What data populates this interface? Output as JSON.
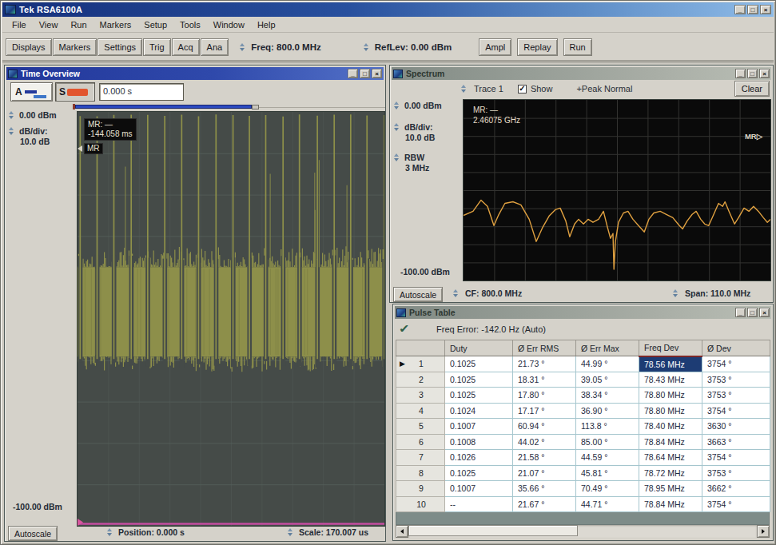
{
  "window": {
    "title": "Tek RSA6100A"
  },
  "menu": {
    "items": [
      "File",
      "View",
      "Run",
      "Markers",
      "Setup",
      "Tools",
      "Window",
      "Help"
    ]
  },
  "toolbar": {
    "buttons": [
      "Displays",
      "Markers",
      "Settings",
      "Trig",
      "Acq",
      "Ana"
    ],
    "freq_label": "Freq: 800.0 MHz",
    "reflev_label": "RefLev: 0.00 dBm",
    "ampl_label": "Ampl",
    "replay_label": "Replay",
    "run_label": "Run"
  },
  "time_overview": {
    "title": "Time Overview",
    "btn_a_letter": "A",
    "btn_s_letter": "S",
    "time_field_value": "0.000 s",
    "top_dbm": "0.00 dBm",
    "dbdiv_label": "dB/div:",
    "dbdiv_value": "10.0 dB",
    "bottom_dbm": "-100.00 dBm",
    "autoscale_label": "Autoscale",
    "position_label": "Position: 0.000 s",
    "scale_label": "Scale: 170.007 us",
    "marker_tooltip_line1": "MR: —",
    "marker_tooltip_line2": "-144.058 ms",
    "marker_badge": "MR",
    "plot": {
      "bg": "#454b48",
      "grid_color": "#56615c",
      "pulse_color": "#8e9049",
      "band_color": "#8d8f4a",
      "magenta": "#c44da0",
      "band_top_frac": 0.375,
      "band_bottom_frac": 0.591,
      "pulse_count": 19,
      "divisions": 10
    }
  },
  "spectrum": {
    "title": "Spectrum",
    "trace_label": "Trace 1",
    "show_label": "Show",
    "check_glyph": "✓",
    "peak_label": "+Peak Normal",
    "clear_label": "Clear",
    "top_dbm": "0.00 dBm",
    "dbdiv_label": "dB/div:",
    "dbdiv_value": "10.0 dB",
    "rbw_label": "RBW",
    "rbw_value": "3 MHz",
    "bottom_dbm": "-100.00 dBm",
    "autoscale_label": "Autoscale",
    "cf_label": "CF: 800.0 MHz",
    "span_label": "Span: 110.0 MHz",
    "marker_line1": "MR: —",
    "marker_line2": "2.46075 GHz",
    "edge_marker": "MR",
    "plot": {
      "bg": "#0a0a0a",
      "grid_color": "#333331",
      "trace_color": "#dfa040",
      "divisions": 10,
      "ylim": [
        -100,
        0
      ],
      "points": [
        [
          0.0,
          -64.0
        ],
        [
          0.031,
          -61.7
        ],
        [
          0.057,
          -55.5
        ],
        [
          0.078,
          -59.0
        ],
        [
          0.099,
          -69.6
        ],
        [
          0.115,
          -63.4
        ],
        [
          0.135,
          -57.3
        ],
        [
          0.161,
          -56.4
        ],
        [
          0.187,
          -58.1
        ],
        [
          0.214,
          -66.1
        ],
        [
          0.237,
          -78.4
        ],
        [
          0.258,
          -70.5
        ],
        [
          0.279,
          -64.3
        ],
        [
          0.299,
          -60.8
        ],
        [
          0.315,
          -59.9
        ],
        [
          0.333,
          -67.0
        ],
        [
          0.346,
          -75.8
        ],
        [
          0.362,
          -68.7
        ],
        [
          0.375,
          -66.1
        ],
        [
          0.391,
          -68.7
        ],
        [
          0.406,
          -66.1
        ],
        [
          0.422,
          -67.8
        ],
        [
          0.44,
          -66.1
        ],
        [
          0.456,
          -61.7
        ],
        [
          0.469,
          -70.5
        ],
        [
          0.479,
          -76.7
        ],
        [
          0.487,
          -74.0
        ],
        [
          0.49,
          -93.8
        ],
        [
          0.495,
          -78.4
        ],
        [
          0.505,
          -67.8
        ],
        [
          0.521,
          -62.6
        ],
        [
          0.536,
          -61.7
        ],
        [
          0.552,
          -66.1
        ],
        [
          0.57,
          -69.6
        ],
        [
          0.589,
          -73.1
        ],
        [
          0.604,
          -66.1
        ],
        [
          0.62,
          -62.6
        ],
        [
          0.641,
          -61.7
        ],
        [
          0.661,
          -63.4
        ],
        [
          0.682,
          -65.2
        ],
        [
          0.703,
          -69.6
        ],
        [
          0.714,
          -71.4
        ],
        [
          0.729,
          -67.0
        ],
        [
          0.745,
          -63.4
        ],
        [
          0.758,
          -61.7
        ],
        [
          0.773,
          -66.1
        ],
        [
          0.786,
          -68.7
        ],
        [
          0.799,
          -69.6
        ],
        [
          0.813,
          -64.3
        ],
        [
          0.831,
          -57.3
        ],
        [
          0.844,
          -59.0
        ],
        [
          0.852,
          -56.4
        ],
        [
          0.865,
          -61.7
        ],
        [
          0.883,
          -68.7
        ],
        [
          0.896,
          -65.2
        ],
        [
          0.914,
          -59.9
        ],
        [
          0.93,
          -61.7
        ],
        [
          0.945,
          -59.0
        ],
        [
          0.961,
          -61.7
        ],
        [
          0.977,
          -65.2
        ],
        [
          0.99,
          -67.8
        ],
        [
          1.0,
          -66.1
        ]
      ]
    }
  },
  "pulse_table": {
    "title": "Pulse Table",
    "check_glyph": "✓",
    "freq_error": "Freq Error: -142.0 Hz (Auto)",
    "columns": [
      "Duty",
      "Ø Err RMS",
      "Ø Err Max",
      "Freq Dev",
      "Ø Dev"
    ],
    "rows": [
      {
        "num": "1",
        "marker": "▶",
        "selected": true,
        "duty": "0.1025",
        "err_rms": "21.73 °",
        "err_max": "44.99 °",
        "freq_dev": "78.56 MHz",
        "phase_dev": "3754 °"
      },
      {
        "num": "2",
        "marker": "",
        "duty": "0.1025",
        "err_rms": "18.31 °",
        "err_max": "39.05 °",
        "freq_dev": "78.43 MHz",
        "phase_dev": "3753 °"
      },
      {
        "num": "3",
        "marker": "",
        "duty": "0.1025",
        "err_rms": "17.80 °",
        "err_max": "38.34 °",
        "freq_dev": "78.80 MHz",
        "phase_dev": "3753 °"
      },
      {
        "num": "4",
        "marker": "",
        "duty": "0.1024",
        "err_rms": "17.17 °",
        "err_max": "36.90 °",
        "freq_dev": "78.80 MHz",
        "phase_dev": "3754 °"
      },
      {
        "num": "5",
        "marker": "",
        "duty": "0.1007",
        "err_rms": "60.94 °",
        "err_max": "113.8 °",
        "freq_dev": "78.40 MHz",
        "phase_dev": "3630 °"
      },
      {
        "num": "6",
        "marker": "",
        "duty": "0.1008",
        "err_rms": "44.02 °",
        "err_max": "85.00 °",
        "freq_dev": "78.84 MHz",
        "phase_dev": "3663 °"
      },
      {
        "num": "7",
        "marker": "",
        "duty": "0.1026",
        "err_rms": "21.58 °",
        "err_max": "44.59 °",
        "freq_dev": "78.64 MHz",
        "phase_dev": "3754 °"
      },
      {
        "num": "8",
        "marker": "",
        "duty": "0.1025",
        "err_rms": "21.07 °",
        "err_max": "45.81 °",
        "freq_dev": "78.72 MHz",
        "phase_dev": "3753 °"
      },
      {
        "num": "9",
        "marker": "",
        "duty": "0.1007",
        "err_rms": "35.66 °",
        "err_max": "70.49 °",
        "freq_dev": "78.95 MHz",
        "phase_dev": "3662 °"
      },
      {
        "num": "10",
        "marker": "",
        "duty": "--",
        "err_rms": "21.67 °",
        "err_max": "44.71 °",
        "freq_dev": "78.84 MHz",
        "phase_dev": "3754 °"
      }
    ]
  },
  "caption_buttons": {
    "minimize": "_",
    "maximize": "□",
    "close": "×"
  }
}
